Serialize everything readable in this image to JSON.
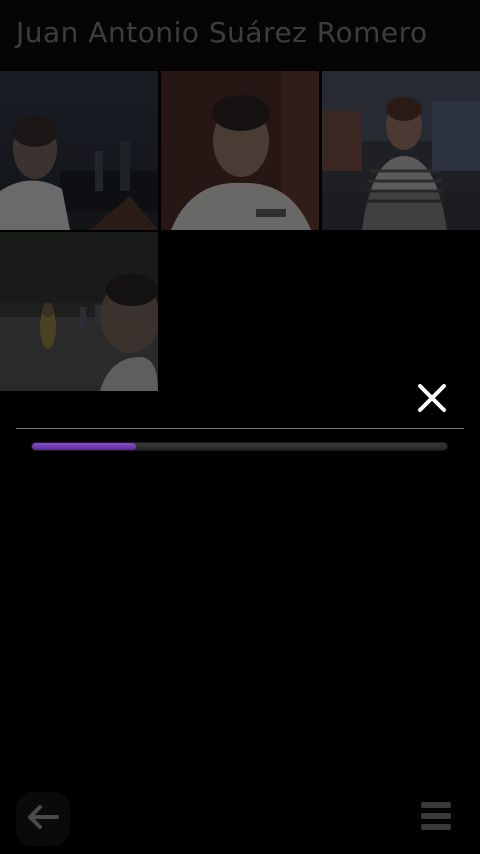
{
  "header": {
    "title": "Juan Antonio Suárez Romero"
  },
  "gallery": {
    "photos": [
      {
        "label": "photo-1"
      },
      {
        "label": "photo-2"
      },
      {
        "label": "photo-3"
      },
      {
        "label": "photo-4"
      }
    ]
  },
  "upload": {
    "progress": 0.25,
    "accent_color": "#7a3fbf"
  },
  "icons": {
    "close": "close-icon",
    "back": "back-arrow-icon",
    "menu": "menu-icon"
  }
}
